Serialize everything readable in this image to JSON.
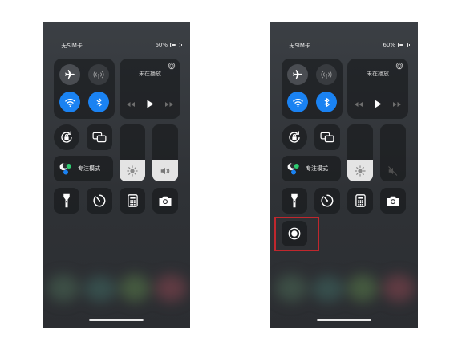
{
  "screens": [
    {
      "carrier": "..... 无SIM卡",
      "battery_text": "60%",
      "battery_level": 0.6,
      "now_playing": "未在播放",
      "focus_label": "专注模式",
      "brightness_level": 0.38,
      "volume_level": 0.38,
      "volume_muted": false,
      "screen_record_shown": false,
      "highlight_shown": false
    },
    {
      "carrier": "..... 无SIM卡",
      "battery_text": "60%",
      "battery_level": 0.6,
      "now_playing": "未在播放",
      "focus_label": "专注模式",
      "brightness_level": 0.38,
      "volume_level": 0,
      "volume_muted": true,
      "screen_record_shown": true,
      "highlight_shown": true
    }
  ],
  "icons": {
    "connectivity": [
      "airplane-icon",
      "cellular-icon",
      "wifi-icon",
      "bluetooth-icon"
    ],
    "media": [
      "airplay-icon",
      "rewind-icon",
      "play-icon",
      "forward-icon"
    ],
    "controls": [
      "orientation-lock-icon",
      "screen-mirroring-icon",
      "focus-icon",
      "brightness-icon",
      "volume-icon"
    ],
    "bottom": [
      "flashlight-icon",
      "timer-icon",
      "calculator-icon",
      "camera-icon",
      "screen-record-icon"
    ]
  },
  "colors": {
    "accent": "#1a82f2",
    "highlight": "#c0272d",
    "slider_fill": "#e4e4e4"
  }
}
